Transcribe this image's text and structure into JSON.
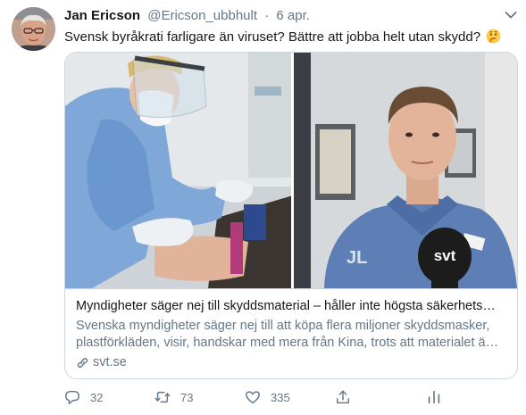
{
  "tweet": {
    "author_name": "Jan Ericson",
    "author_handle": "@Ericson_ubbhult",
    "separator": "·",
    "date": "6 apr.",
    "text": "Svensk byråkrati farligare än viruset? Bättre att jobba helt utan skydd?",
    "emoji": "thinking-face-emoji"
  },
  "card": {
    "image_label": "svt",
    "title": "Myndigheter säger nej till skyddsmaterial – håller inte högsta säkerhets…",
    "description": "Svenska myndigheter säger nej till att köpa flera miljoner skyddsmasker, plastförkläden, visir, handskar med mera från Kina, trots att materialet ä…",
    "domain": "svt.se",
    "domain_icon": "link-icon"
  },
  "actions": {
    "reply_count": "32",
    "retweet_count": "73",
    "like_count": "335",
    "reply_icon": "reply-icon",
    "retweet_icon": "retweet-icon",
    "like_icon": "heart-icon",
    "share_icon": "share-icon",
    "analytics_icon": "analytics-icon"
  },
  "colors": {
    "primary_text": "#14171a",
    "secondary_text": "#657786",
    "border": "#ccd6dd"
  }
}
